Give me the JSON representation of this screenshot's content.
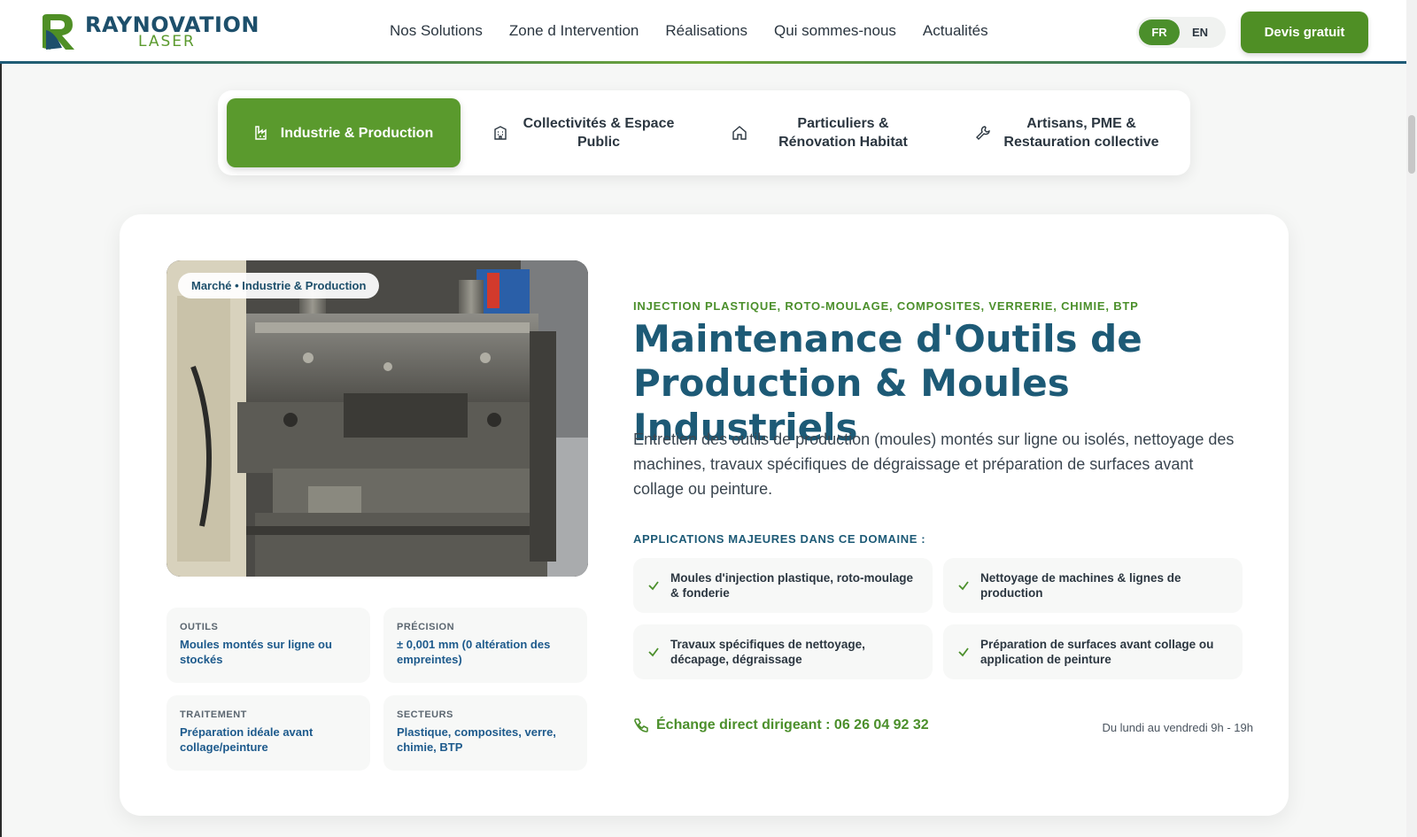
{
  "header": {
    "logo_primary": "RAYNOVATION",
    "logo_secondary": "LASER",
    "nav": [
      "Nos Solutions",
      "Zone d Intervention",
      "Réalisations",
      "Qui sommes-nous",
      "Actualités"
    ],
    "lang": {
      "fr": "FR",
      "en": "EN",
      "active": "FR"
    },
    "cta_label": "Devis gratuit"
  },
  "tabs": [
    {
      "label": "Industrie & Production",
      "icon": "factory-icon",
      "active": true
    },
    {
      "label": "Collectivités & Espace Public",
      "icon": "building-icon",
      "active": false
    },
    {
      "label": "Particuliers & Rénovation Habitat",
      "icon": "home-icon",
      "active": false
    },
    {
      "label": "Artisans, PME & Restauration collective",
      "icon": "wrench-icon",
      "active": false
    }
  ],
  "card": {
    "badge": "Marché • Industrie & Production",
    "specs": [
      {
        "key": "OUTILS",
        "value": "Moules montés sur ligne ou stockés"
      },
      {
        "key": "PRÉCISION",
        "value": "± 0,001 mm (0 altération des empreintes)"
      },
      {
        "key": "TRAITEMENT",
        "value": "Préparation idéale avant collage/peinture"
      },
      {
        "key": "SECTEURS",
        "value": "Plastique, composites, verre, chimie, BTP"
      }
    ],
    "eyebrow": "INJECTION PLASTIQUE, ROTO-MOULAGE, COMPOSITES, VERRERIE, CHIMIE, BTP",
    "title": "Maintenance d'Outils de Production & Moules Industriels",
    "description": "Entretien des outils de production (moules) montés sur ligne ou isolés, nettoyage des machines, travaux spécifiques de dégraissage et préparation de surfaces avant collage ou peinture.",
    "apps_heading": "APPLICATIONS MAJEURES DANS CE DOMAINE :",
    "apps": [
      "Moules d'injection plastique, roto-moulage & fonderie",
      "Nettoyage de machines & lignes de production",
      "Travaux spécifiques de nettoyage, décapage, dégraissage",
      "Préparation de surfaces avant collage ou application de peinture"
    ],
    "contact": "Échange direct dirigeant : 06 26 04 92 32",
    "hours": "Du lundi au vendredi 9h - 19h"
  },
  "colors": {
    "brand_green": "#4f8f25",
    "brand_blue": "#1d5a76",
    "link_blue": "#1d5a8c"
  }
}
